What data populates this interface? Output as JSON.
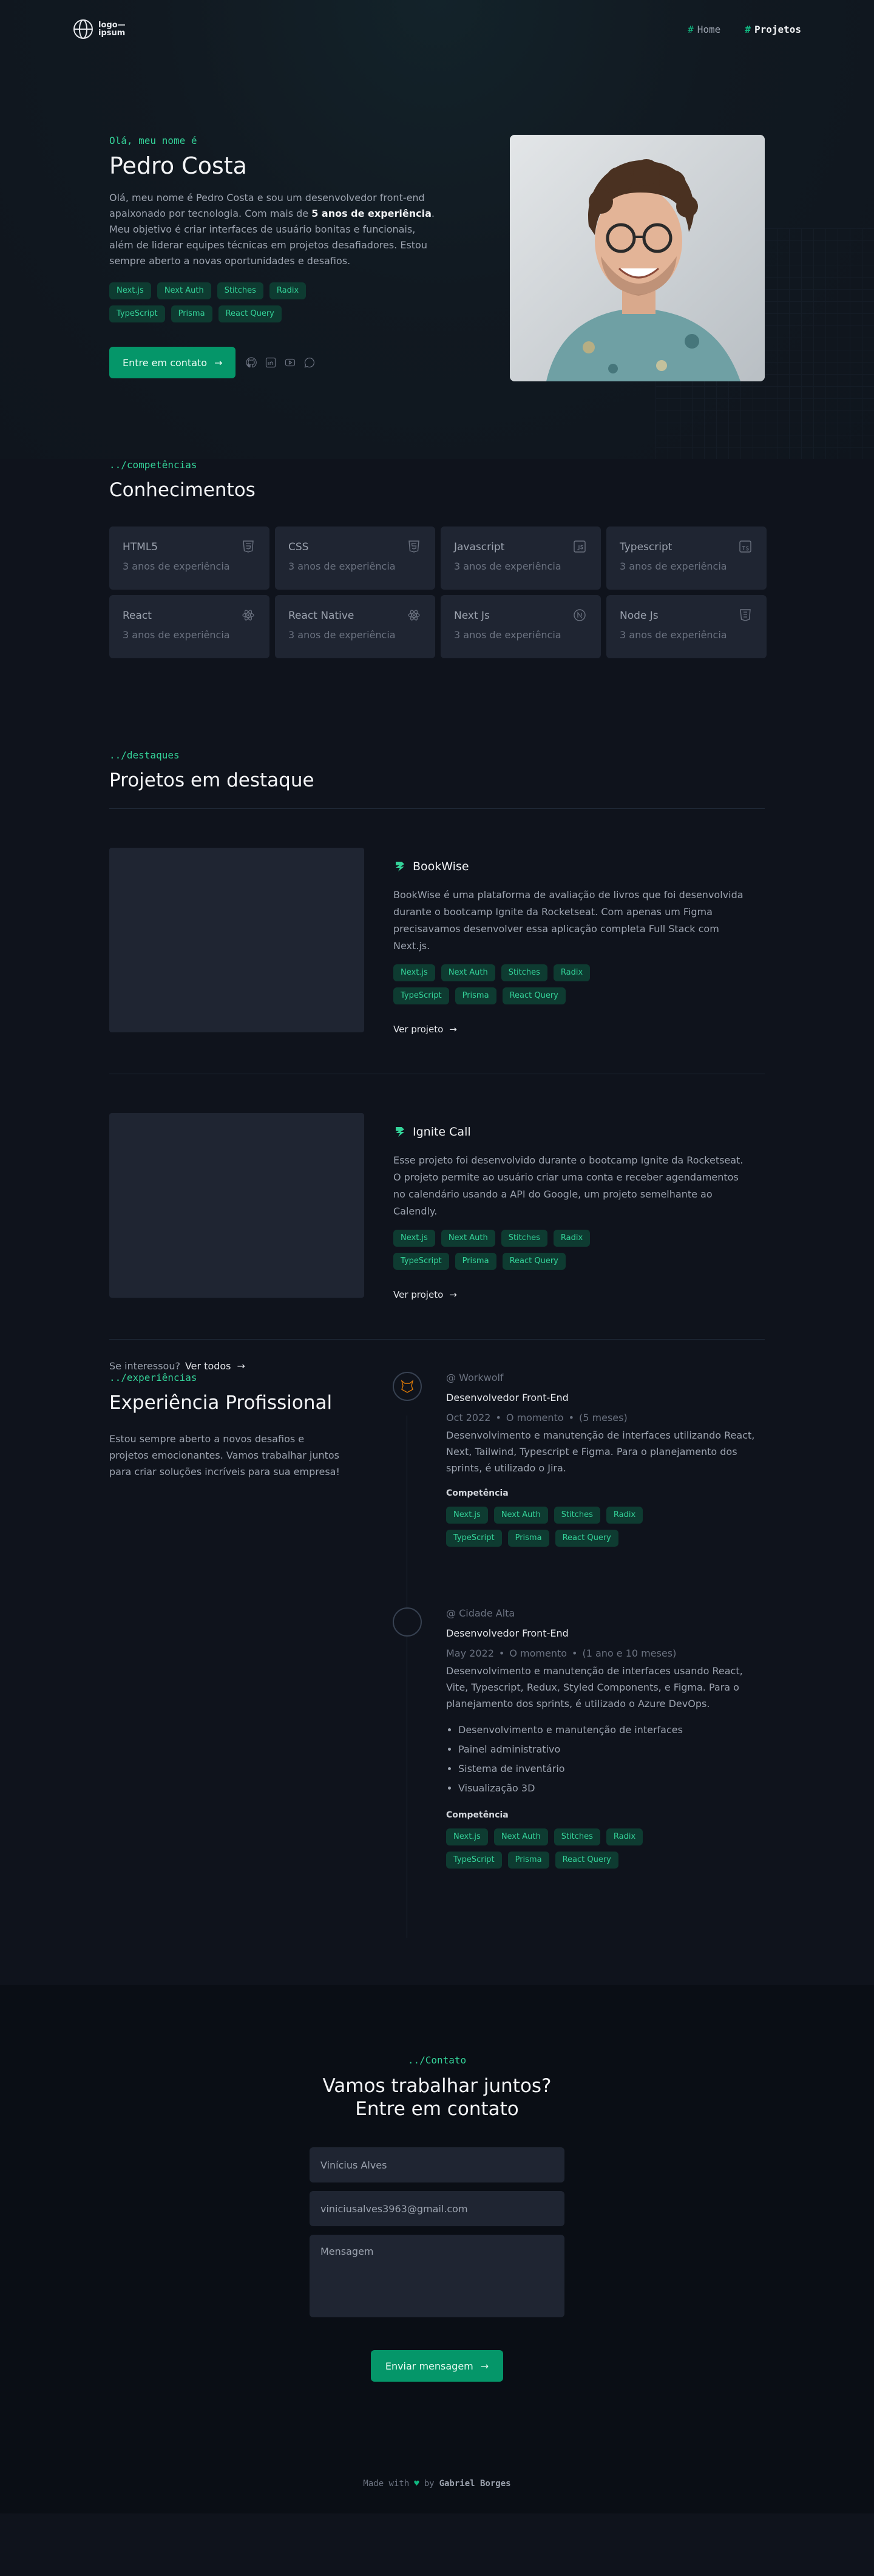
{
  "header": {
    "logo_text": "logo—\nipsum",
    "nav": [
      {
        "label": "Home",
        "active": false
      },
      {
        "label": "Projetos",
        "active": true
      }
    ],
    "nav_hash": "#"
  },
  "hero": {
    "greeting": "Olá, meu nome é",
    "name": "Pedro Costa",
    "desc_before": "Olá, meu nome é Pedro Costa e sou um desenvolvedor front-end apaixonado por tecnologia. Com mais de ",
    "desc_bold": "5 anos de experiência",
    "desc_after": ". Meu objetivo é criar interfaces de usuário bonitas e funcionais, além de liderar equipes técnicas em projetos desafiadores. Estou sempre aberto a novas oportunidades e desafios.",
    "tags": [
      "Next.js",
      "Next Auth",
      "Stitches",
      "Radix",
      "TypeScript",
      "Prisma",
      "React Query"
    ],
    "cta": "Entre em contato",
    "socials": [
      "github-icon",
      "linkedin-icon",
      "youtube-icon",
      "whatsapp-icon"
    ]
  },
  "skills": {
    "label": "../competências",
    "title": "Conhecimentos",
    "items": [
      {
        "name": "HTML5",
        "exp": "3 anos de experiência",
        "icon": "html5-icon"
      },
      {
        "name": "CSS",
        "exp": "3 anos de experiência",
        "icon": "css-icon"
      },
      {
        "name": "Javascript",
        "exp": "3 anos de experiência",
        "icon": "javascript-icon"
      },
      {
        "name": "Typescript",
        "exp": "3 anos de experiência",
        "icon": "typescript-icon"
      },
      {
        "name": "React",
        "exp": "3 anos de experiência",
        "icon": "react-icon"
      },
      {
        "name": "React Native",
        "exp": "3 anos de experiência",
        "icon": "react-native-icon"
      },
      {
        "name": "Next Js",
        "exp": "3 anos de experiência",
        "icon": "nextjs-icon"
      },
      {
        "name": "Node Js",
        "exp": "3 anos de experiência",
        "icon": "nodejs-icon"
      }
    ]
  },
  "projects": {
    "label": "../destaques",
    "title": "Projetos em destaque",
    "items": [
      {
        "title": "BookWise",
        "desc": "BookWise é uma plataforma de avaliação de livros que foi desenvolvida durante o bootcamp Ignite da Rocketseat. Com apenas um Figma precisavamos desenvolver essa aplicação completa Full Stack com Next.js.",
        "tags": [
          "Next.js",
          "Next Auth",
          "Stitches",
          "Radix",
          "TypeScript",
          "Prisma",
          "React Query"
        ],
        "link": "Ver projeto"
      },
      {
        "title": "Ignite Call",
        "desc": "Esse projeto foi desenvolvido durante o bootcamp Ignite da Rocketseat. O projeto permite ao usuário criar uma conta e receber agendamentos no calendário usando a API do Google, um projeto semelhante ao Calendly.",
        "tags": [
          "Next.js",
          "Next Auth",
          "Stitches",
          "Radix",
          "TypeScript",
          "Prisma",
          "React Query"
        ],
        "link": "Ver projeto"
      }
    ],
    "more_prompt": "Se interessou?",
    "more_link": "Ver todos"
  },
  "experience": {
    "label": "../experiências",
    "title": "Experiência Profissional",
    "desc": "Estou sempre aberto a novos desafios e projetos emocionantes. Vamos trabalhar juntos para criar soluções incríveis para sua empresa!",
    "jobs": [
      {
        "company": "@ Workwolf",
        "role": "Desenvolvedor Front-End",
        "start": "Oct 2022",
        "end": "O momento",
        "duration": "(5 meses)",
        "desc": "Desenvolvimento e manutenção de interfaces utilizando React, Next, Tailwind, Typescript e Figma. Para o planejamento dos sprints, é utilizado o Jira.",
        "bullets": [],
        "comp_label": "Competência",
        "tags": [
          "Next.js",
          "Next Auth",
          "Stitches",
          "Radix",
          "TypeScript",
          "Prisma",
          "React Query"
        ]
      },
      {
        "company": "@ Cidade Alta",
        "role": "Desenvolvedor Front-End",
        "start": "May 2022",
        "end": "O momento",
        "duration": "(1 ano e 10 meses)",
        "desc": "Desenvolvimento e manutenção de interfaces usando React, Vite, Typescript, Redux, Styled Components, e Figma. Para o planejamento dos sprints, é utilizado o Azure DevOps.",
        "bullets": [
          "Desenvolvimento e manutenção de interfaces",
          "Painel administrativo",
          "Sistema de inventário",
          "Visualização 3D"
        ],
        "comp_label": "Competência",
        "tags": [
          "Next.js",
          "Next Auth",
          "Stitches",
          "Radix",
          "TypeScript",
          "Prisma",
          "React Query"
        ]
      }
    ]
  },
  "contact": {
    "label": "../Contato",
    "title_line1": "Vamos trabalhar juntos?",
    "title_line2": "Entre em contato",
    "name_value": "Vinícius Alves",
    "email_value": "viniciusalves3963@gmail.com",
    "message_placeholder": "Mensagem",
    "send": "Enviar mensagem"
  },
  "footer": {
    "made_with": "Made with",
    "by": "by",
    "author": "Gabriel Borges"
  },
  "colors": {
    "accent": "#059669",
    "accent_text": "#34d399",
    "tag_bg": "#0e3b31",
    "card_bg": "#1f2532",
    "page_bg": "#0f131c"
  }
}
